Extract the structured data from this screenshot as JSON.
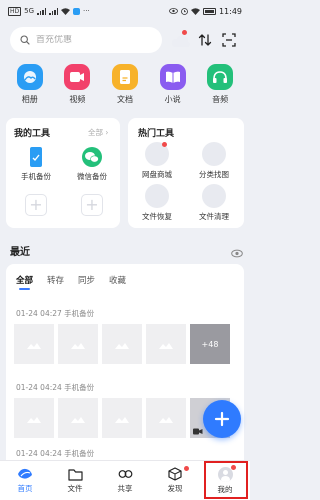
{
  "status": {
    "left_text": "HD",
    "network": "5G",
    "time": "11:49"
  },
  "search": {
    "placeholder": "首充优惠"
  },
  "quick_actions": [
    {
      "label": "相册",
      "icon": "photo-album-icon",
      "color": "#2a9df4"
    },
    {
      "label": "视频",
      "icon": "video-icon",
      "color": "#f2416b"
    },
    {
      "label": "文档",
      "icon": "document-icon",
      "color": "#f7b22a"
    },
    {
      "label": "小说",
      "icon": "novel-icon",
      "color": "#8a5cf0"
    },
    {
      "label": "音频",
      "icon": "audio-icon",
      "color": "#23c07a"
    }
  ],
  "my_tools": {
    "title": "我的工具",
    "all_link": "全部",
    "items": [
      {
        "label": "手机备份",
        "icon": "phone-backup-icon"
      },
      {
        "label": "微信备份",
        "icon": "wechat-backup-icon"
      }
    ]
  },
  "hot_tools": {
    "title": "热门工具",
    "items": [
      {
        "label": "网盘商城"
      },
      {
        "label": "分类找图"
      },
      {
        "label": "文件恢复"
      },
      {
        "label": "文件清理"
      }
    ]
  },
  "recent": {
    "title": "最近",
    "tabs": [
      "全部",
      "转存",
      "同步",
      "收藏"
    ],
    "groups": [
      {
        "meta": "01-24 04:27   手机备份",
        "more": "+48"
      },
      {
        "meta": "01-24 04:24   手机备份"
      },
      {
        "meta": "01-24 04:24   手机备份"
      }
    ]
  },
  "nav": {
    "items": [
      {
        "label": "首页",
        "icon": "home-icon"
      },
      {
        "label": "文件",
        "icon": "folder-icon"
      },
      {
        "label": "共享",
        "icon": "share-icon"
      },
      {
        "label": "发现",
        "icon": "discover-icon"
      },
      {
        "label": "我的",
        "icon": "profile-icon"
      }
    ]
  },
  "colors": {
    "accent": "#2f7bff",
    "highlight": "#e12020"
  }
}
